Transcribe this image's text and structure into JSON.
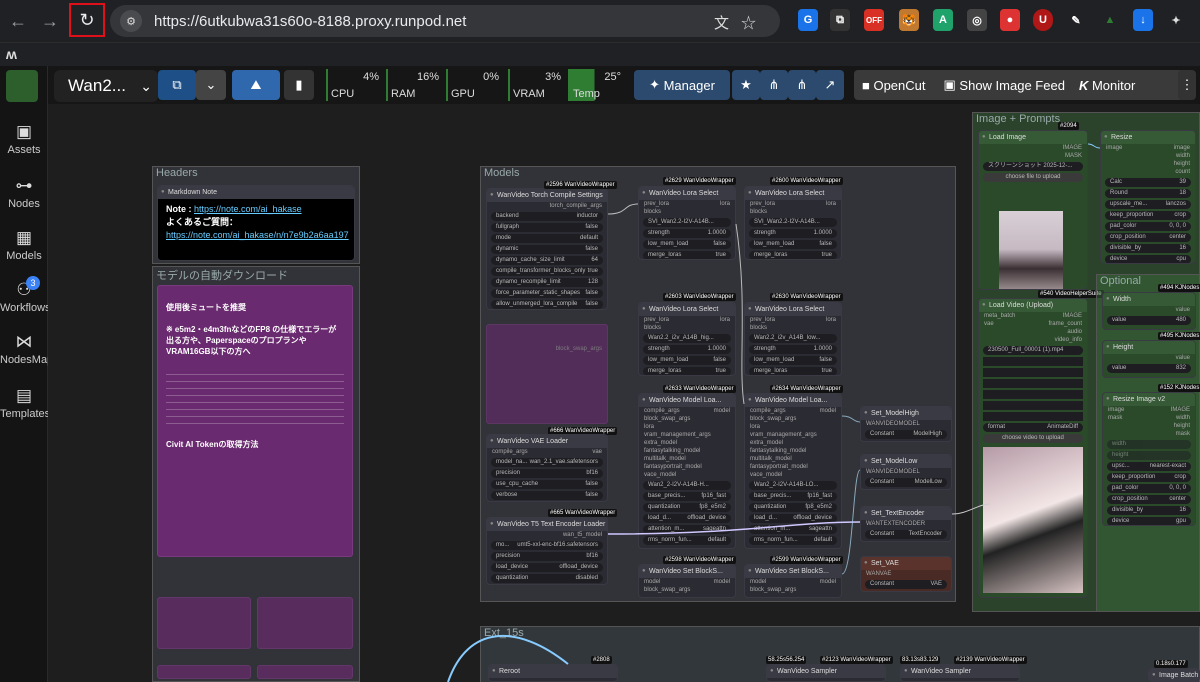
{
  "browser": {
    "url": "https://6utkubwa31s60o-8188.proxy.runpod.net",
    "site_icon": "⚙",
    "ext_labels": {
      "off": "OFF",
      "u": "U",
      "g": "G"
    }
  },
  "sidebar": {
    "items": [
      {
        "label": "Assets",
        "icon": "image-icon"
      },
      {
        "label": "Nodes",
        "icon": "nodes-icon"
      },
      {
        "label": "Models",
        "icon": "models-icon"
      },
      {
        "label": "Workflows",
        "icon": "workflows-icon",
        "badge": "3"
      },
      {
        "label": "NodesMap",
        "icon": "nodesmap-icon"
      },
      {
        "label": "Templates",
        "icon": "templates-icon"
      }
    ]
  },
  "topbar": {
    "workflow_name": "Wan2...",
    "stats": [
      {
        "label": "CPU",
        "value": "4%"
      },
      {
        "label": "RAM",
        "value": "16%"
      },
      {
        "label": "GPU",
        "value": "0%"
      },
      {
        "label": "VRAM",
        "value": "3%"
      },
      {
        "label": "Temp",
        "value": "25°"
      }
    ],
    "manager_label": "Manager",
    "opencut_label": "OpenCut",
    "image_feed_label": "Show Image Feed",
    "monitor_label": "Monitor"
  },
  "canvas": {
    "groups": {
      "headers": "Headers",
      "auto_download": "モデルの自動ダウンロード",
      "models": "Models",
      "image_prompts": "Image + Prompts",
      "optional": "Optional",
      "ext": "Ext_15s"
    },
    "note": {
      "title": "Markdown Note",
      "note_label": "Note :",
      "note_link": "https://note.com/ai_hakase",
      "faq_label": "よくあるご質問：",
      "faq_link": "https://note.com/ai_hakase/n/n7e9b2a6aa197"
    },
    "dl_note": {
      "heading": "使用後ミュートを推奨",
      "sub": "※ e5m2・e4m3fnなどのFP8 の仕様でエラーが出る方や、Paperspaceのプロプランや VRAM16GB以下の方へ",
      "civit": "Civit AI Tokenの取得方法"
    },
    "nodes": {
      "torch_compile": {
        "tag": "#2596 WanVideoWrapper",
        "title": "WanVideo Torch Compile Settings",
        "out": "torch_compile_args",
        "widgets": [
          [
            "backend",
            "inductor"
          ],
          [
            "fullgraph",
            "false"
          ],
          [
            "mode",
            "default"
          ],
          [
            "dynamic",
            "false"
          ],
          [
            "dynamo_cache_size_limit",
            "64"
          ],
          [
            "compile_transformer_blocks_only",
            "true"
          ],
          [
            "dynamo_recompile_limit",
            "128"
          ],
          [
            "force_parameter_static_shapes",
            "false"
          ],
          [
            "allow_unmerged_lora_compile",
            "false"
          ]
        ]
      },
      "lora1": {
        "tag": "#2629 WanVideoWrapper",
        "title": "WanVideo Lora Select",
        "lora": "SVI_Wan2.2-I2V-A14B...",
        "strength": "1.0000",
        "low_mem": "false",
        "merge": "true"
      },
      "lora2": {
        "tag": "#2600 WanVideoWrapper",
        "title": "WanVideo Lora Select",
        "lora": "SVI_Wan2.2-I2V-A14B...",
        "strength": "1.0000",
        "low_mem": "false",
        "merge": "true"
      },
      "lora3": {
        "tag": "#2603 WanVideoWrapper",
        "title": "WanVideo Lora Select",
        "lora": "Wan2.2_i2v_A14B_hig...",
        "strength": "1.0000",
        "low_mem": "false",
        "merge": "true"
      },
      "lora4": {
        "tag": "#2630 WanVideoWrapper",
        "title": "WanVideo Lora Select",
        "lora": "Wan2.2_i2v_A14B_low...",
        "strength": "1.0000",
        "low_mem": "false",
        "merge": "true"
      },
      "vae": {
        "tag": "#666 WanVideoWrapper",
        "title": "WanVideo VAE Loader",
        "model": "wan_2.1_vae.safetensors",
        "precision": "bf16",
        "cpu": "false",
        "verbose": "false"
      },
      "t5": {
        "tag": "#665 WanVideoWrapper",
        "title": "WanVideo T5 Text Encoder Loader",
        "out": "wan_t5_model",
        "model": "umt5-xxl-enc-bf16.safetensors",
        "precision": "bf16",
        "load": "offload_device",
        "quant": "disabled"
      },
      "model1": {
        "tag": "#2633 WanVideoWrapper",
        "title": "WanVideo Model Loa...",
        "model": "Wan2_2-I2V-A14B-H...",
        "prec": "fp16_fast",
        "quant": "fp8_e5m2",
        "load": "offload_device",
        "attn": "sageattn",
        "rms": "default"
      },
      "model2": {
        "tag": "#2634 WanVideoWrapper",
        "title": "WanVideo Model Loa...",
        "model": "Wan2_2-I2V-A14B-LO...",
        "prec": "fp16_fast",
        "quant": "fp8_e5m2",
        "load": "offload_device",
        "attn": "sageattn",
        "rms": "default"
      },
      "blockswap1": {
        "tag": "#2598 WanVideoWrapper",
        "title": "WanVideo Set BlockS..."
      },
      "blockswap2": {
        "tag": "#2599 WanVideoWrapper",
        "title": "WanVideo Set BlockS..."
      },
      "set_high": {
        "title": "Set_ModelHigh",
        "out": "WANVIDEOMODEL",
        "const": "ModelHigh"
      },
      "set_low": {
        "title": "Set_ModelLow",
        "out": "WANVIDEOMODEL",
        "const": "ModelLow"
      },
      "set_te": {
        "title": "Set_TextEncoder",
        "out": "WANTEXTENCODER",
        "const": "TextEncoder"
      },
      "set_vae": {
        "title": "Set_VAE",
        "out": "WANVAE",
        "const": "VAE"
      },
      "load_image": {
        "tag": "#2094",
        "title": "Load Image",
        "file": "スクリーンショット 2025-12-...",
        "btn": "choose file to upload"
      },
      "resize": {
        "title": "Resize",
        "vals": [
          [
            "Calc",
            "39"
          ],
          [
            "Round",
            "18"
          ],
          [
            "upscale_me...",
            "lanczos"
          ],
          [
            "keep_proportion",
            "crop"
          ],
          [
            "pad_color",
            "0, 0, 0"
          ],
          [
            "crop_position",
            "center"
          ],
          [
            "divisible_by",
            "16"
          ],
          [
            "device",
            "cpu"
          ]
        ]
      },
      "load_video": {
        "tag": "#540 VideoHelperSuite",
        "title": "Load Video (Upload)",
        "file": "230500_Full_00001 (1).mp4",
        "format": "AnimateDiff",
        "btn": "choose video to upload"
      },
      "width": {
        "tag": "#494 KJNodes",
        "title": "Width",
        "value": "480"
      },
      "height": {
        "tag": "#495 KJNodes",
        "title": "Height",
        "value": "832"
      },
      "resize2": {
        "tag": "#152 KJNodes",
        "title": "Resize Image v2",
        "vals": [
          [
            "upsc...",
            "nearest-exact"
          ],
          [
            "keep_proportion",
            "crop"
          ],
          [
            "pad_color",
            "0, 0, 0"
          ],
          [
            "crop_position",
            "center"
          ],
          [
            "divisible_by",
            "16"
          ],
          [
            "device",
            "gpu"
          ]
        ]
      },
      "reroot": {
        "tag": "#2808",
        "title": "Reroot"
      },
      "sampler1": {
        "tag": "#2123 WanVideoWrapper",
        "title": "WanVideo Sampler",
        "time": "58.25s56.254"
      },
      "sampler2": {
        "tag": "#2139 WanVideoWrapper",
        "title": "WanVideo Sampler",
        "time": "83.13s83.129"
      },
      "img_batch": {
        "title": "Image Batch E...",
        "time": "0.18s0.177"
      }
    }
  }
}
